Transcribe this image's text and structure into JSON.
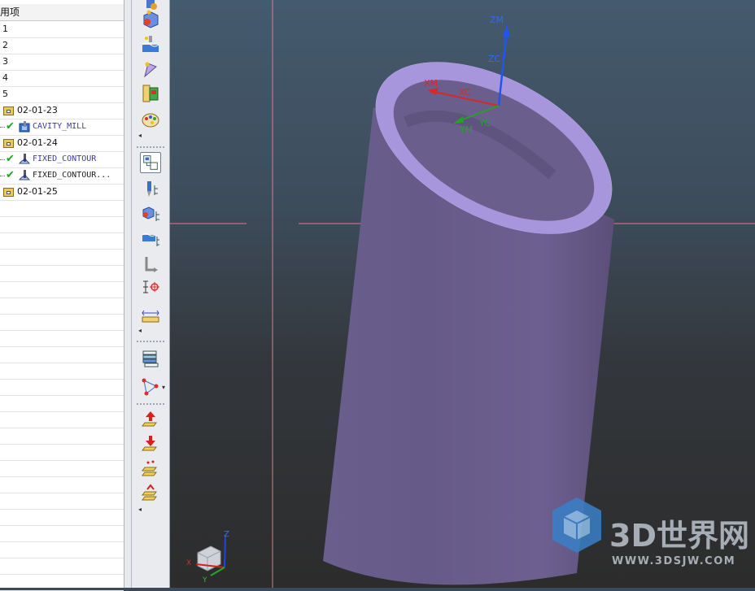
{
  "navigator": {
    "header": "用项",
    "rows": [
      {
        "kind": "plain",
        "label": "1"
      },
      {
        "kind": "plain",
        "label": "2"
      },
      {
        "kind": "plain",
        "label": "3"
      },
      {
        "kind": "plain",
        "label": "4"
      },
      {
        "kind": "plain",
        "label": "5"
      },
      {
        "kind": "group",
        "label": "02-01-23"
      },
      {
        "kind": "operation",
        "label": "CAVITY_MILL"
      },
      {
        "kind": "group",
        "label": "02-01-24"
      },
      {
        "kind": "operation",
        "label": "FIXED_CONTOUR"
      },
      {
        "kind": "operation",
        "label": "FIXED_CONTOUR..."
      },
      {
        "kind": "group",
        "label": "02-01-25"
      }
    ]
  },
  "viewport": {
    "wcs_labels": {
      "zm": "ZM",
      "zc": "ZC",
      "xm": "XM",
      "xc": "XC",
      "ym": "YM",
      "yc": "YC"
    },
    "triad_labels": {
      "z": "Z",
      "x": "X",
      "y": "Y"
    },
    "part_color": "#6b5e8a",
    "background_top": "#445a6e",
    "background_bottom": "#2c2c2c"
  },
  "watermark": {
    "brand": "3D世界网",
    "url": "WWW.3DSJW.COM"
  },
  "toolbar_icons": [
    "create-tool-icon",
    "create-geometry-icon",
    "create-method-icon",
    "create-program-icon",
    "color-palette-icon",
    "program-order-view-icon",
    "machine-tool-view-icon",
    "geometry-view-icon",
    "machining-method-view-icon",
    "tool-path-icon",
    "mcs-icon",
    "measure-icon",
    "layer-list-icon",
    "manufacturing-navigator-icon",
    "move-up-icon",
    "move-down-icon",
    "generate-icon",
    "verify-icon"
  ]
}
